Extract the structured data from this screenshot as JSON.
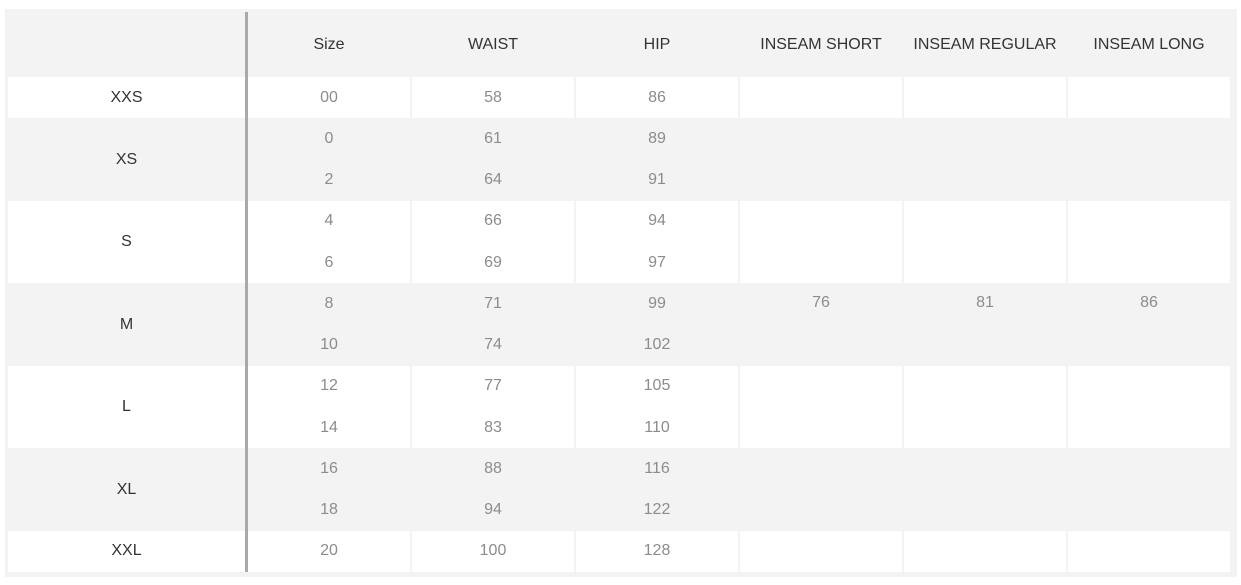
{
  "headers": [
    "",
    "Size",
    "WAIST",
    "HIP",
    "INSEAM SHORT",
    "INSEAM REGULAR",
    "INSEAM LONG"
  ],
  "groups": [
    {
      "label": "XXS",
      "rows": [
        [
          "00",
          "58",
          "86"
        ]
      ]
    },
    {
      "label": "XS",
      "rows": [
        [
          "0",
          "61",
          "89"
        ],
        [
          "2",
          "64",
          "91"
        ]
      ]
    },
    {
      "label": "S",
      "rows": [
        [
          "4",
          "66",
          "94"
        ],
        [
          "6",
          "69",
          "97"
        ]
      ]
    },
    {
      "label": "M",
      "rows": [
        [
          "8",
          "71",
          "99"
        ],
        [
          "10",
          "74",
          "102"
        ]
      ],
      "inseam": [
        "76",
        "81",
        "86"
      ]
    },
    {
      "label": "L",
      "rows": [
        [
          "12",
          "77",
          "105"
        ],
        [
          "14",
          "83",
          "110"
        ]
      ]
    },
    {
      "label": "XL",
      "rows": [
        [
          "16",
          "88",
          "116"
        ],
        [
          "18",
          "94",
          "122"
        ]
      ]
    },
    {
      "label": "XXL",
      "rows": [
        [
          "20",
          "100",
          "128"
        ]
      ]
    }
  ],
  "colors": {
    "header_bg": "#f3f3f3",
    "alt_bg": "#f3f3f3",
    "row_bg": "#ffffff",
    "label_text": "#333333",
    "value_text": "#8c8c8c",
    "divider": "#a9a9a9"
  }
}
